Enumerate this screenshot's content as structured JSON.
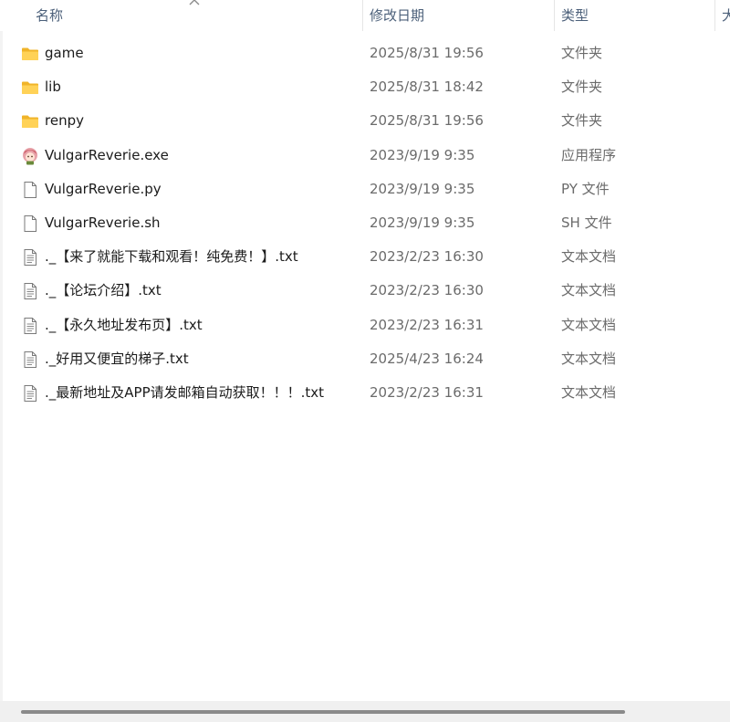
{
  "columns": {
    "name": "名称",
    "date": "修改日期",
    "type": "类型",
    "size": "大"
  },
  "sort": {
    "column": "name",
    "icon": "sort-chevron-up-icon"
  },
  "files": [
    {
      "name": "game",
      "date": "2025/8/31 19:56",
      "type": "文件夹",
      "icon": "folder-icon"
    },
    {
      "name": "lib",
      "date": "2025/8/31 18:42",
      "type": "文件夹",
      "icon": "folder-icon"
    },
    {
      "name": "renpy",
      "date": "2025/8/31 19:56",
      "type": "文件夹",
      "icon": "folder-icon"
    },
    {
      "name": "VulgarReverie.exe",
      "date": "2023/9/19 9:35",
      "type": "应用程序",
      "icon": "app-avatar-icon"
    },
    {
      "name": "VulgarReverie.py",
      "date": "2023/9/19 9:35",
      "type": "PY 文件",
      "icon": "blank-file-icon"
    },
    {
      "name": "VulgarReverie.sh",
      "date": "2023/9/19 9:35",
      "type": "SH 文件",
      "icon": "blank-file-icon"
    },
    {
      "name": "._【来了就能下载和观看！纯免费！】.txt",
      "date": "2023/2/23 16:30",
      "type": "文本文档",
      "icon": "text-file-icon"
    },
    {
      "name": "._【论坛介绍】.txt",
      "date": "2023/2/23 16:30",
      "type": "文本文档",
      "icon": "text-file-icon"
    },
    {
      "name": "._【永久地址发布页】.txt",
      "date": "2023/2/23 16:31",
      "type": "文本文档",
      "icon": "text-file-icon"
    },
    {
      "name": "._好用又便宜的梯子.txt",
      "date": "2025/4/23 16:24",
      "type": "文本文档",
      "icon": "text-file-icon"
    },
    {
      "name": "._最新地址及APP请发邮箱自动获取！！！.txt",
      "date": "2023/2/23 16:31",
      "type": "文本文档",
      "icon": "text-file-icon"
    }
  ],
  "colors": {
    "header_text": "#4c607a",
    "folder": "#f4c430",
    "secondary_text": "#6b6b6b"
  }
}
